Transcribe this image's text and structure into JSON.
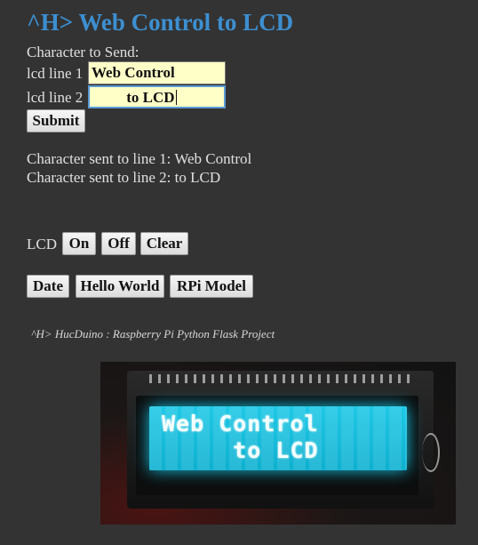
{
  "page": {
    "title": "^H> Web Control to LCD",
    "prompt_label": "Character to Send:"
  },
  "form": {
    "line1_label": "lcd line 1",
    "line1_value": "Web Control",
    "line2_label": "lcd line 2",
    "line2_value": "         to LCD",
    "submit_label": "Submit"
  },
  "status": {
    "line1": "Character sent to line 1: Web Control",
    "line2": "Character sent to line 2: to LCD"
  },
  "lcd_controls": {
    "label": "LCD",
    "on_label": "On",
    "off_label": "Off",
    "clear_label": "Clear"
  },
  "quick_actions": {
    "date_label": "Date",
    "hello_label": "Hello World",
    "rpi_label": "RPi Model"
  },
  "footer": {
    "note": "^H> HucDuino : Raspberry Pi Python Flask Project"
  },
  "photo": {
    "lcd_line1": "Web Control",
    "lcd_line2": "     to LCD",
    "lcd_color": "#1ec8e6"
  },
  "colors": {
    "background": "#333333",
    "title": "#3d8fd0",
    "input_bg": "#ffffc8"
  }
}
